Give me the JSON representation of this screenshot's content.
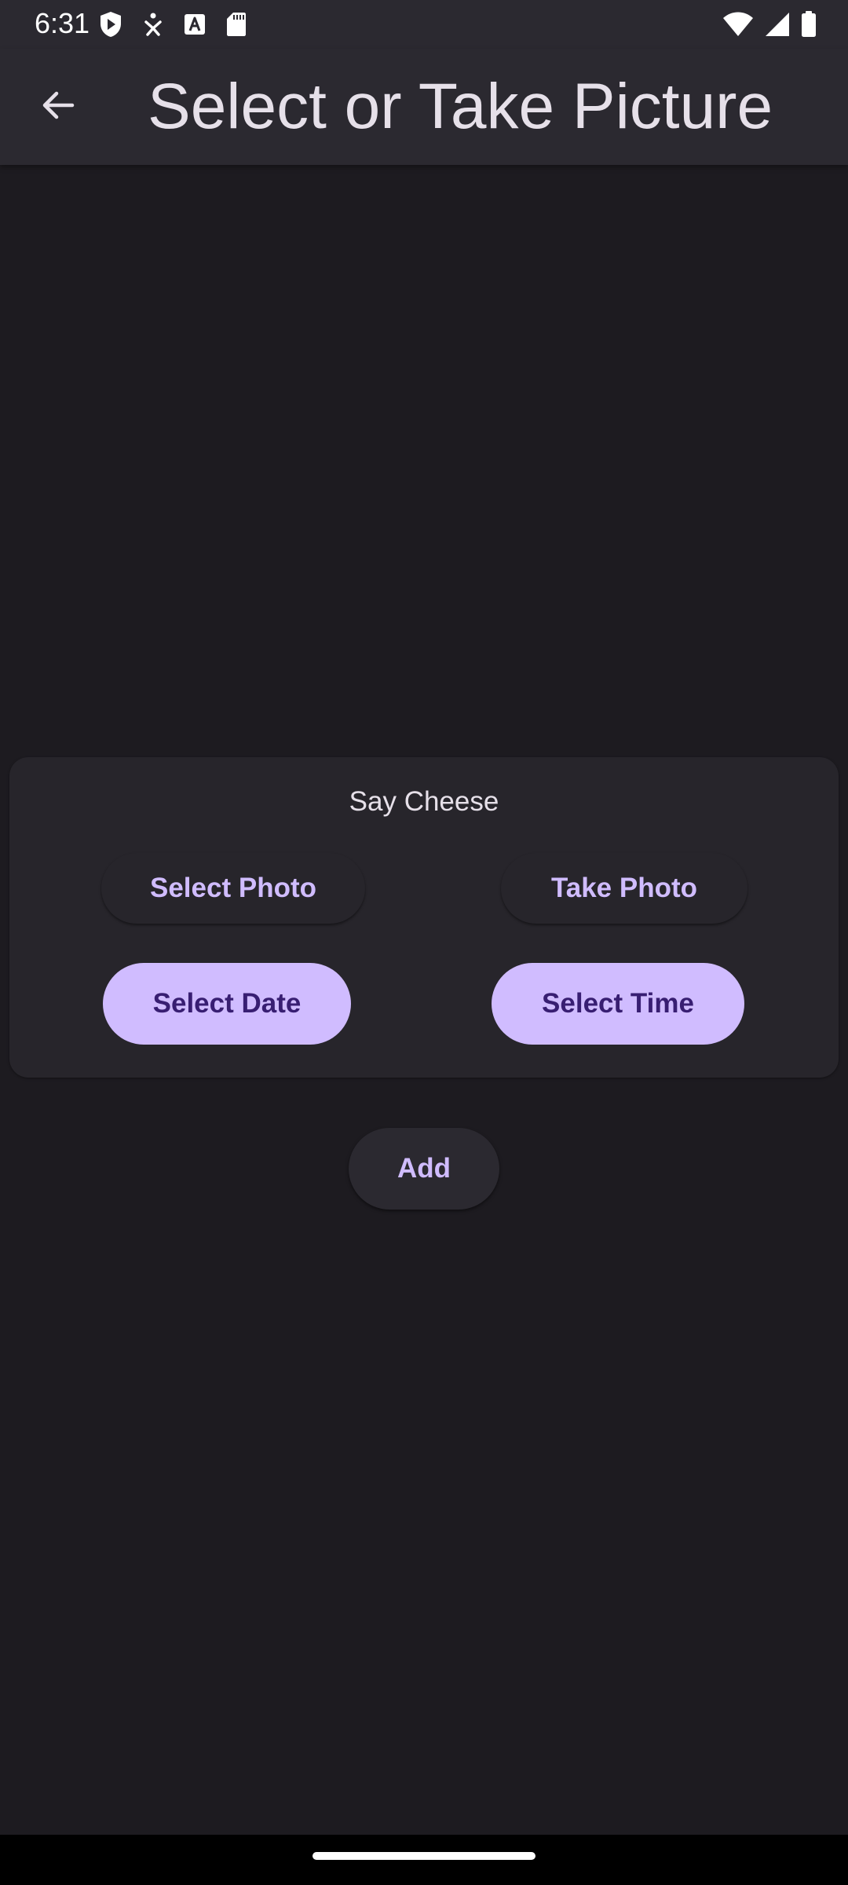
{
  "status_bar": {
    "time": "6:31",
    "left_icons": [
      "play-protect-icon",
      "accessibility-icon",
      "font-icon",
      "sd-card-icon"
    ],
    "right_icons": [
      "wifi-icon",
      "cellular-signal-icon",
      "battery-icon"
    ]
  },
  "app_bar": {
    "back_icon": "arrow-back-icon",
    "title": "Select or Take Picture"
  },
  "card": {
    "title": "Say Cheese",
    "select_photo_label": "Select Photo",
    "take_photo_label": "Take Photo",
    "select_date_label": "Select Date",
    "select_time_label": "Select Time"
  },
  "add_label": "Add",
  "colors": {
    "background": "#1d1b20",
    "surface": "#2b2930",
    "card": "#27252b",
    "primary": "#d0bcff",
    "on_primary": "#381e72",
    "on_surface": "#e6e0e9"
  }
}
